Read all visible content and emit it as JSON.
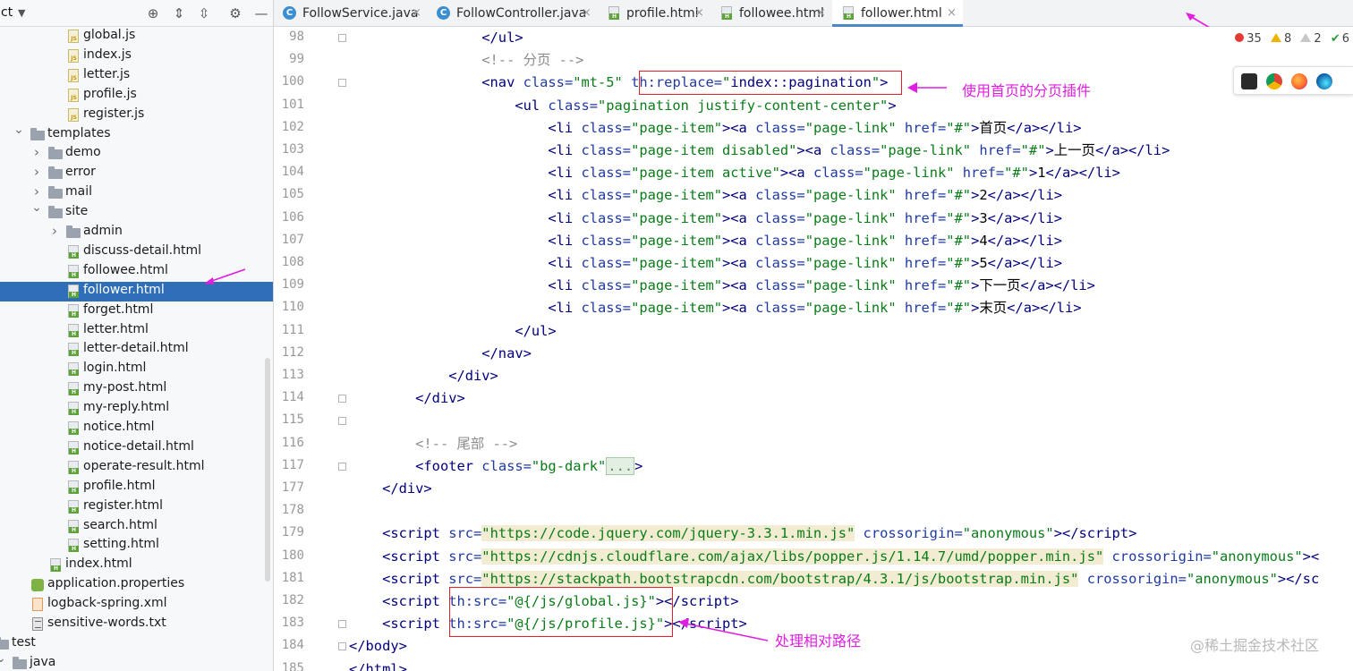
{
  "panel": {
    "title": "ct",
    "items": [
      {
        "label": "global.js",
        "type": "js",
        "indent": 1
      },
      {
        "label": "index.js",
        "type": "js",
        "indent": 1
      },
      {
        "label": "letter.js",
        "type": "js",
        "indent": 1
      },
      {
        "label": "profile.js",
        "type": "js",
        "indent": 1
      },
      {
        "label": "register.js",
        "type": "js",
        "indent": 1
      },
      {
        "label": "templates",
        "type": "folder",
        "indent": -1,
        "expanded": true
      },
      {
        "label": "demo",
        "type": "folder",
        "indent": 0,
        "expanded": false
      },
      {
        "label": "error",
        "type": "folder",
        "indent": 0,
        "expanded": false
      },
      {
        "label": "mail",
        "type": "folder",
        "indent": 0,
        "expanded": false
      },
      {
        "label": "site",
        "type": "folder",
        "indent": 0,
        "expanded": true
      },
      {
        "label": "admin",
        "type": "folder",
        "indent": 1,
        "expanded": false
      },
      {
        "label": "discuss-detail.html",
        "type": "html",
        "indent": 1
      },
      {
        "label": "followee.html",
        "type": "html",
        "indent": 1
      },
      {
        "label": "follower.html",
        "type": "html",
        "indent": 1,
        "selected": true
      },
      {
        "label": "forget.html",
        "type": "html",
        "indent": 1
      },
      {
        "label": "letter.html",
        "type": "html",
        "indent": 1
      },
      {
        "label": "letter-detail.html",
        "type": "html",
        "indent": 1
      },
      {
        "label": "login.html",
        "type": "html",
        "indent": 1
      },
      {
        "label": "my-post.html",
        "type": "html",
        "indent": 1
      },
      {
        "label": "my-reply.html",
        "type": "html",
        "indent": 1
      },
      {
        "label": "notice.html",
        "type": "html",
        "indent": 1
      },
      {
        "label": "notice-detail.html",
        "type": "html",
        "indent": 1
      },
      {
        "label": "operate-result.html",
        "type": "html",
        "indent": 1
      },
      {
        "label": "profile.html",
        "type": "html",
        "indent": 1
      },
      {
        "label": "register.html",
        "type": "html",
        "indent": 1
      },
      {
        "label": "search.html",
        "type": "html",
        "indent": 1
      },
      {
        "label": "setting.html",
        "type": "html",
        "indent": 1
      },
      {
        "label": "index.html",
        "type": "html",
        "indent": 0
      },
      {
        "label": "application.properties",
        "type": "prop",
        "indent": -1
      },
      {
        "label": "logback-spring.xml",
        "type": "xml",
        "indent": -1
      },
      {
        "label": "sensitive-words.txt",
        "type": "txt",
        "indent": -1
      },
      {
        "label": "test",
        "type": "folder",
        "indent": -3,
        "expanded": true
      },
      {
        "label": "java",
        "type": "folder",
        "indent": -2,
        "expanded": true
      }
    ]
  },
  "tabs": [
    {
      "label": "FollowService.java",
      "kind": "class",
      "active": false
    },
    {
      "label": "FollowController.java",
      "kind": "class",
      "active": false
    },
    {
      "label": "profile.html",
      "kind": "html",
      "active": false
    },
    {
      "label": "followee.html",
      "kind": "html",
      "active": false
    },
    {
      "label": "follower.html",
      "kind": "html",
      "active": true
    }
  ],
  "tab_close": "×",
  "inspections": {
    "errors": "35",
    "warnings": "8",
    "weak": "2",
    "ok": "6",
    "ok_mark": "✔"
  },
  "editor": {
    "lines": [
      {
        "n": "98",
        "html": "                <span class=\"tg\">&lt;/ul&gt;</span>"
      },
      {
        "n": "99",
        "html": "                <span class=\"cm\">&lt;!-- 分页 --&gt;</span>"
      },
      {
        "n": "100",
        "html": "                <span class=\"tg\">&lt;nav </span><span class=\"at\">class=</span><span class=\"st\">\"mt-5\"</span> <span class=\"at\">th:replace=</span><span class=\"st\">\"</span><span class=\"tg\">index::pagination</span><span class=\"st\">\"</span><span class=\"tg\">&gt;</span>"
      },
      {
        "n": "101",
        "html": "                    <span class=\"tg\">&lt;ul </span><span class=\"at\">class=</span><span class=\"st\">\"pagination justify-content-center\"</span><span class=\"tg\">&gt;</span>"
      },
      {
        "n": "102",
        "html": "                        <span class=\"tg\">&lt;li </span><span class=\"at\">class=</span><span class=\"st\">\"page-item\"</span><span class=\"tg\">&gt;&lt;a </span><span class=\"at\">class=</span><span class=\"st\">\"page-link\"</span> <span class=\"at\">href=</span><span class=\"st\">\"#\"</span><span class=\"tg\">&gt;</span>首页<span class=\"tg\">&lt;/a&gt;&lt;/li&gt;</span>"
      },
      {
        "n": "103",
        "html": "                        <span class=\"tg\">&lt;li </span><span class=\"at\">class=</span><span class=\"st\">\"page-item disabled\"</span><span class=\"tg\">&gt;&lt;a </span><span class=\"at\">class=</span><span class=\"st\">\"page-link\"</span> <span class=\"at\">href=</span><span class=\"st\">\"#\"</span><span class=\"tg\">&gt;</span>上一页<span class=\"tg\">&lt;/a&gt;&lt;/li&gt;</span>"
      },
      {
        "n": "104",
        "html": "                        <span class=\"tg\">&lt;li </span><span class=\"at\">class=</span><span class=\"st\">\"page-item active\"</span><span class=\"tg\">&gt;&lt;a </span><span class=\"at\">class=</span><span class=\"st\">\"page-link\"</span> <span class=\"at\">href=</span><span class=\"st\">\"#\"</span><span class=\"tg\">&gt;</span>1<span class=\"tg\">&lt;/a&gt;&lt;/li&gt;</span>"
      },
      {
        "n": "105",
        "html": "                        <span class=\"tg\">&lt;li </span><span class=\"at\">class=</span><span class=\"st\">\"page-item\"</span><span class=\"tg\">&gt;&lt;a </span><span class=\"at\">class=</span><span class=\"st\">\"page-link\"</span> <span class=\"at\">href=</span><span class=\"st\">\"#\"</span><span class=\"tg\">&gt;</span>2<span class=\"tg\">&lt;/a&gt;&lt;/li&gt;</span>"
      },
      {
        "n": "106",
        "html": "                        <span class=\"tg\">&lt;li </span><span class=\"at\">class=</span><span class=\"st\">\"page-item\"</span><span class=\"tg\">&gt;&lt;a </span><span class=\"at\">class=</span><span class=\"st\">\"page-link\"</span> <span class=\"at\">href=</span><span class=\"st\">\"#\"</span><span class=\"tg\">&gt;</span>3<span class=\"tg\">&lt;/a&gt;&lt;/li&gt;</span>"
      },
      {
        "n": "107",
        "html": "                        <span class=\"tg\">&lt;li </span><span class=\"at\">class=</span><span class=\"st\">\"page-item\"</span><span class=\"tg\">&gt;&lt;a </span><span class=\"at\">class=</span><span class=\"st\">\"page-link\"</span> <span class=\"at\">href=</span><span class=\"st\">\"#\"</span><span class=\"tg\">&gt;</span>4<span class=\"tg\">&lt;/a&gt;&lt;/li&gt;</span>"
      },
      {
        "n": "108",
        "html": "                        <span class=\"tg\">&lt;li </span><span class=\"at\">class=</span><span class=\"st\">\"page-item\"</span><span class=\"tg\">&gt;&lt;a </span><span class=\"at\">class=</span><span class=\"st\">\"page-link\"</span> <span class=\"at\">href=</span><span class=\"st\">\"#\"</span><span class=\"tg\">&gt;</span>5<span class=\"tg\">&lt;/a&gt;&lt;/li&gt;</span>"
      },
      {
        "n": "109",
        "html": "                        <span class=\"tg\">&lt;li </span><span class=\"at\">class=</span><span class=\"st\">\"page-item\"</span><span class=\"tg\">&gt;&lt;a </span><span class=\"at\">class=</span><span class=\"st\">\"page-link\"</span> <span class=\"at\">href=</span><span class=\"st\">\"#\"</span><span class=\"tg\">&gt;</span>下一页<span class=\"tg\">&lt;/a&gt;&lt;/li&gt;</span>"
      },
      {
        "n": "110",
        "html": "                        <span class=\"tg\">&lt;li </span><span class=\"at\">class=</span><span class=\"st\">\"page-item\"</span><span class=\"tg\">&gt;&lt;a </span><span class=\"at\">class=</span><span class=\"st\">\"page-link\"</span> <span class=\"at\">href=</span><span class=\"st\">\"#\"</span><span class=\"tg\">&gt;</span>末页<span class=\"tg\">&lt;/a&gt;&lt;/li&gt;</span>"
      },
      {
        "n": "111",
        "html": "                    <span class=\"tg\">&lt;/ul&gt;</span>"
      },
      {
        "n": "112",
        "html": "                <span class=\"tg\">&lt;/nav&gt;</span>"
      },
      {
        "n": "113",
        "html": "            <span class=\"tg\">&lt;/div&gt;</span>"
      },
      {
        "n": "114",
        "html": "        <span class=\"tg\">&lt;/div&gt;</span>"
      },
      {
        "n": "115",
        "html": ""
      },
      {
        "n": "116",
        "html": "        <span class=\"cm\">&lt;!-- 尾部 --&gt;</span>"
      },
      {
        "n": "117",
        "html": "        <span class=\"tg\">&lt;footer </span><span class=\"at\">class=</span><span class=\"st\">\"bg-dark\"</span><span class=\"fold-dots\">...</span><span class=\"tg\">&gt;</span>"
      },
      {
        "n": "177",
        "html": "    <span class=\"tg\">&lt;/div&gt;</span>"
      },
      {
        "n": "178",
        "html": ""
      },
      {
        "n": "179",
        "html": "    <span class=\"tg\">&lt;script </span><span class=\"at\">src=</span><span class=\"st hl\">\"https://code.jquery.com/jquery-3.3.1.min.js\"</span> <span class=\"at\">crossorigin=</span><span class=\"st\">\"anonymous\"</span><span class=\"tg\">&gt;&lt;/script&gt;</span>"
      },
      {
        "n": "180",
        "html": "    <span class=\"tg\">&lt;script </span><span class=\"at\">src=</span><span class=\"st hl\">\"https://cdnjs.cloudflare.com/ajax/libs/popper.js/1.14.7/umd/popper.min.js\"</span> <span class=\"at\">crossorigin=</span><span class=\"st\">\"anonymous\"</span><span class=\"tg\">&gt;&lt;</span>"
      },
      {
        "n": "181",
        "html": "    <span class=\"tg\">&lt;script </span><span class=\"at\">src=</span><span class=\"st hl\">\"https://stackpath.bootstrapcdn.com/bootstrap/4.3.1/js/bootstrap.min.js\"</span> <span class=\"at\">crossorigin=</span><span class=\"st\">\"anonymous\"</span><span class=\"tg\">&gt;&lt;/sc</span>"
      },
      {
        "n": "182",
        "html": "    <span class=\"tg\">&lt;script </span><span class=\"at\">th:src=</span><span class=\"st\">\"@{/js/global.js}\"</span><span class=\"tg\">&gt;&lt;/script&gt;</span>"
      },
      {
        "n": "183",
        "html": "    <span class=\"tg\">&lt;script </span><span class=\"at\">th:src=</span><span class=\"st\">\"@{/js/profile.js}\"</span><span class=\"tg\">&gt;&lt;/script&gt;</span>"
      },
      {
        "n": "184",
        "html": "<span class=\"tg\">&lt;/body&gt;</span>"
      },
      {
        "n": "185",
        "html": "<span class=\"tg\">&lt;/html&gt;</span>"
      }
    ],
    "folds": [
      0,
      2,
      16,
      17,
      19,
      26,
      27
    ]
  },
  "annotations": {
    "pagination_note": "使用首页的分页插件",
    "path_note": "处理相对路径"
  },
  "watermark": "@稀土掘金技术社区",
  "colors": {
    "accent": "#e01ee0",
    "highlight_box": "#e0202a",
    "selection": "#2f6fb7"
  }
}
